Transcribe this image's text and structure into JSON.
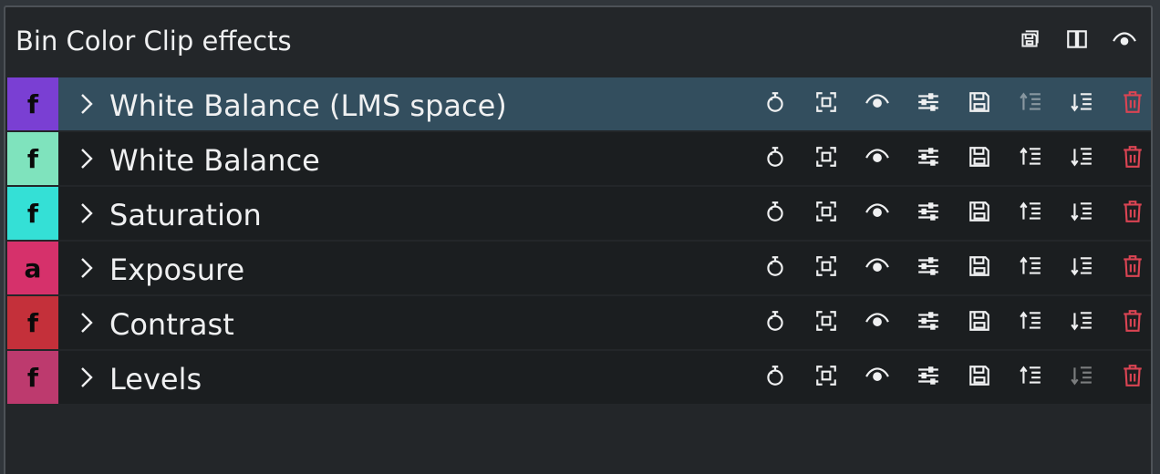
{
  "panel": {
    "title": "Bin Color Clip effects",
    "actions": [
      {
        "name": "save-stack-icon"
      },
      {
        "name": "compare-icon"
      },
      {
        "name": "visibility-icon"
      }
    ]
  },
  "colors": {
    "selected_row": "#334e5e",
    "row": "#1b1e20",
    "delete": "#da4453"
  },
  "effects": [
    {
      "type": "f",
      "label": "White Balance (LMS space)",
      "color": "#7a3fd3",
      "selected": true,
      "move_up_enabled": false,
      "move_down_enabled": true
    },
    {
      "type": "f",
      "label": "White Balance",
      "color": "#7fe3bd",
      "selected": false,
      "move_up_enabled": true,
      "move_down_enabled": true
    },
    {
      "type": "f",
      "label": "Saturation",
      "color": "#34e0d6",
      "selected": false,
      "move_up_enabled": true,
      "move_down_enabled": true
    },
    {
      "type": "a",
      "label": "Exposure",
      "color": "#d6316b",
      "selected": false,
      "move_up_enabled": true,
      "move_down_enabled": true
    },
    {
      "type": "f",
      "label": "Contrast",
      "color": "#c4303a",
      "selected": false,
      "move_up_enabled": true,
      "move_down_enabled": true
    },
    {
      "type": "f",
      "label": "Levels",
      "color": "#bd3a6e",
      "selected": false,
      "move_up_enabled": true,
      "move_down_enabled": false
    }
  ]
}
